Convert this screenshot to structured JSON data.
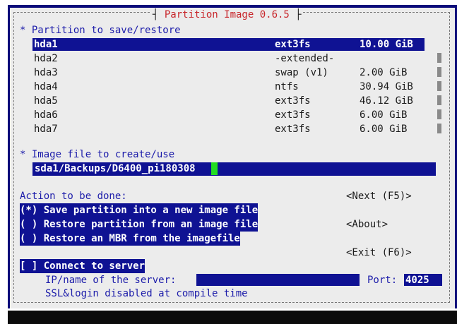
{
  "title": "Partition Image 0.6.5",
  "partition_header": "* Partition to save/restore",
  "partitions": [
    {
      "name": "hda1",
      "fs": "ext3fs",
      "size": "10.00 GiB"
    },
    {
      "name": "hda2",
      "fs": "-extended-",
      "size": ""
    },
    {
      "name": "hda3",
      "fs": "swap (v1)",
      "size": "2.00 GiB"
    },
    {
      "name": "hda4",
      "fs": "ntfs",
      "size": "30.94 GiB"
    },
    {
      "name": "hda5",
      "fs": "ext3fs",
      "size": "46.12 GiB"
    },
    {
      "name": "hda6",
      "fs": "ext3fs",
      "size": "6.00 GiB"
    },
    {
      "name": "hda7",
      "fs": "ext3fs",
      "size": "6.00 GiB"
    }
  ],
  "image_header": "* Image file to create/use",
  "image_file": "sda1/Backups/D6400_pi180308",
  "action_header": "Action to be done:",
  "actions": [
    "(*) Save partition into a new image file",
    "( ) Restore partition from an image file",
    "( ) Restore an MBR from the imagefile"
  ],
  "buttons": {
    "next": "<Next (F5)>",
    "about": "<About>",
    "exit": "<Exit (F6)>"
  },
  "connect_label": "[ ] Connect to server",
  "server_label": "IP/name of the server:",
  "server_value": "",
  "port_label": "Port:",
  "port_value": "4025",
  "ssl_note": "SSL&login disabled at compile time",
  "colors": {
    "dialog_bg": "#ececec",
    "selection": "#0f1293",
    "title": "#c8272c",
    "header": "#1c1caa",
    "cursor": "#22dd22"
  }
}
